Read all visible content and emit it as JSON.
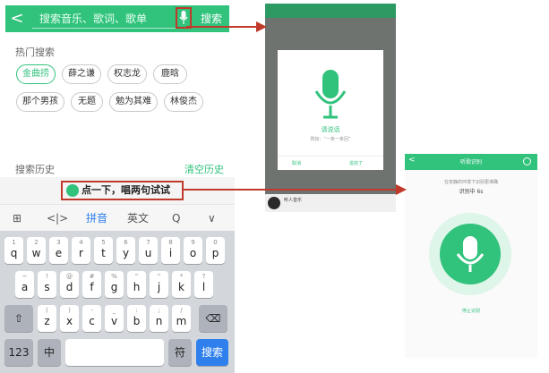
{
  "search": {
    "back": "<",
    "placeholder": "搜索音乐、歌词、歌单",
    "button": "搜索"
  },
  "hot": {
    "title": "热门搜索",
    "tags": [
      "金曲捞",
      "薛之谦",
      "权志龙",
      "鹿晗",
      "那个男孩",
      "无题",
      "勉为其难",
      "林俊杰"
    ]
  },
  "history": {
    "title": "搜索历史",
    "clear": "清空历史"
  },
  "voice_hint": "点一下，唱两句试试",
  "toolbar": {
    "pinyin": "拼音",
    "english": "英文",
    "search_symbol": "Q",
    "collapse": "∨"
  },
  "keyboard": {
    "row1": [
      {
        "num": "1",
        "ch": "q"
      },
      {
        "num": "2",
        "ch": "w"
      },
      {
        "num": "3",
        "ch": "e"
      },
      {
        "num": "4",
        "ch": "r"
      },
      {
        "num": "5",
        "ch": "t"
      },
      {
        "num": "6",
        "ch": "y"
      },
      {
        "num": "7",
        "ch": "u"
      },
      {
        "num": "8",
        "ch": "i"
      },
      {
        "num": "9",
        "ch": "o"
      },
      {
        "num": "0",
        "ch": "p"
      }
    ],
    "row2": [
      {
        "num": "~",
        "ch": "a"
      },
      {
        "num": "!",
        "ch": "s"
      },
      {
        "num": "@",
        "ch": "d"
      },
      {
        "num": "#",
        "ch": "f"
      },
      {
        "num": "%",
        "ch": "g"
      },
      {
        "num": "\"",
        "ch": "h"
      },
      {
        "num": "\"",
        "ch": "j"
      },
      {
        "num": "*",
        "ch": "k"
      },
      {
        "num": "?",
        "ch": "l"
      }
    ],
    "row3": [
      {
        "num": "(",
        "ch": "z"
      },
      {
        "num": ")",
        "ch": "x"
      },
      {
        "num": "-",
        "ch": "c"
      },
      {
        "num": "_",
        "ch": "v"
      },
      {
        "num": ":",
        "ch": "b"
      },
      {
        "num": ";",
        "ch": "n"
      },
      {
        "num": "/",
        "ch": "m"
      }
    ],
    "shift": "⇧",
    "delete": "⌫",
    "key_123": "123",
    "key_zh": "中",
    "key_space": "",
    "key_symbol": "符",
    "key_search": "搜索"
  },
  "mid_dialog": {
    "prompt": "请说话",
    "example": "例如：“一条一条回”",
    "cancel": "取消",
    "done": "说完了",
    "player_title": "听人音乐"
  },
  "right_screen": {
    "title": "听歌识别",
    "hint": "在安静的环境下识别更准确",
    "status": "识别中 6s",
    "cancel": "停止识别"
  },
  "colors": {
    "brand_green": "#31c27c",
    "highlight_red": "#c0392b",
    "keyboard_blue": "#2f80ed"
  }
}
